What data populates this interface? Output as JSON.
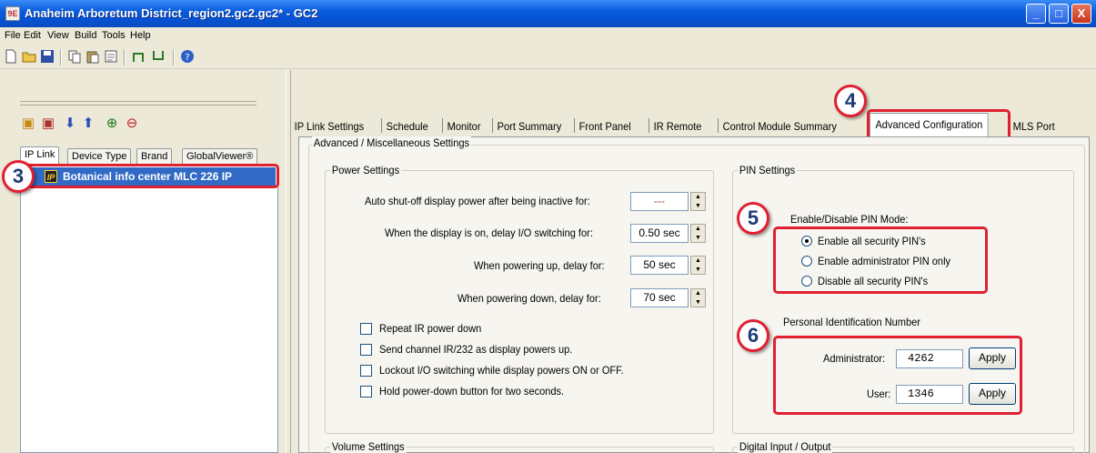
{
  "window": {
    "title": "Anaheim Arboretum District_region2.gc2.gc2* - GC2",
    "minimize": "_",
    "maximize": "□",
    "close": "X"
  },
  "menu": [
    "File",
    "Edit",
    "View",
    "Build",
    "Tools",
    "Help"
  ],
  "left": {
    "tabs": [
      "IP Link",
      "Device Type",
      "Brand",
      "GlobalViewer®"
    ],
    "tree_item": "Botanical info center MLC 226 IP",
    "tree_icon": "IP"
  },
  "callouts": {
    "c3": "3",
    "c4": "4",
    "c5": "5",
    "c6": "6"
  },
  "tabs": [
    "IP Link Settings",
    "Schedule",
    "Monitor",
    "Port Summary",
    "Front Panel",
    "IR Remote",
    "Control Module Summary",
    "Advanced Configuration",
    "MLS Port"
  ],
  "page": {
    "title": "Advanced / Miscellaneous Settings",
    "power": {
      "title": "Power Settings",
      "rows": [
        {
          "label": "Auto shut-off display power after being inactive for:",
          "value": "---"
        },
        {
          "label": "When the display is on, delay I/O switching  for:",
          "value": "0.50 sec"
        },
        {
          "label": "When powering up, delay for:",
          "value": "50 sec"
        },
        {
          "label": "When powering down, delay for:",
          "value": "70 sec"
        }
      ],
      "checks": [
        "Repeat IR power down",
        "Send channel IR/232 as display powers up.",
        "Lockout I/O switching while display powers ON or OFF.",
        "Hold power-down button for two seconds."
      ]
    },
    "pin": {
      "title": "PIN Settings",
      "mode_title": "Enable/Disable PIN Mode:",
      "modes": [
        "Enable all security PIN's",
        "Enable administrator PIN only",
        "Disable all security PIN's"
      ],
      "selected": 0,
      "pid_title": "Personal Identification Number",
      "admin_label": "Administrator:",
      "admin_value": "4262",
      "user_label": "User:",
      "user_value": "1346",
      "apply": "Apply"
    },
    "volume_title": "Volume Settings",
    "dio_title": "Digital Input / Output"
  },
  "colors": {
    "callout_red": "#e02030",
    "selection": "#316ac5"
  }
}
